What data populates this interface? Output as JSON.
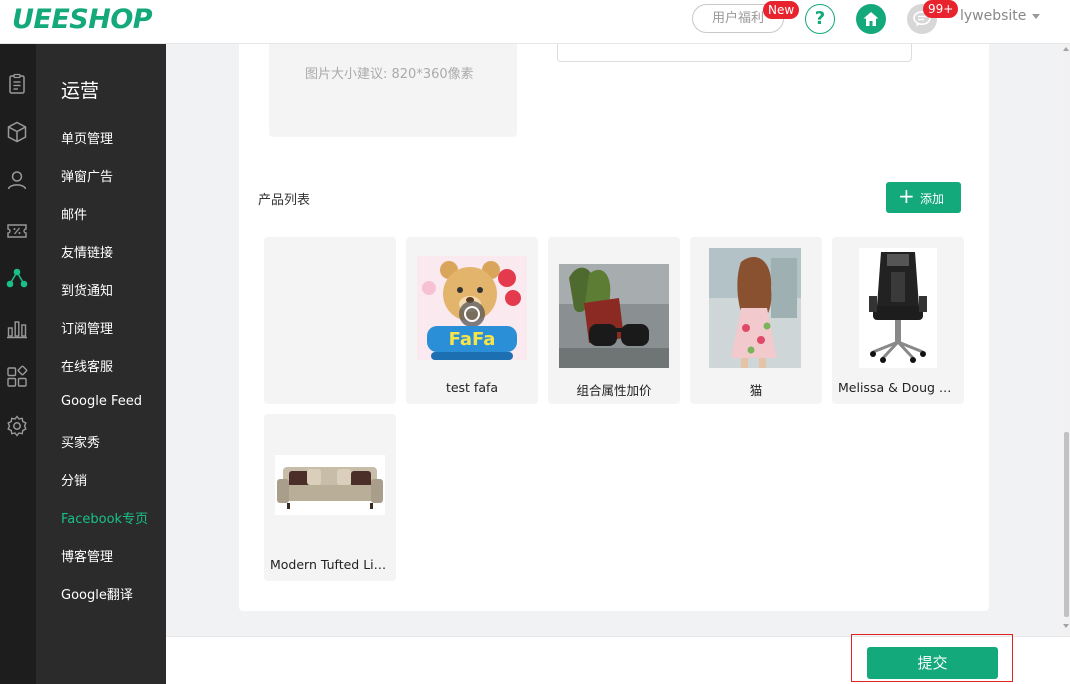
{
  "header": {
    "logo_text": "UEESHOP",
    "welfare_label": "用户福利",
    "new_badge": "New",
    "help_label": "?",
    "message_badge": "99+",
    "username": "lywebsite"
  },
  "iconbar": {
    "icons": [
      "clipboard-icon",
      "package-icon",
      "user-icon",
      "discount-icon",
      "share-icon",
      "bar-chart-icon",
      "apps-icon",
      "settings-icon"
    ],
    "active_icon": "share-icon"
  },
  "submenu": {
    "title": "运营",
    "items": [
      {
        "label": "单页管理"
      },
      {
        "label": "弹窗广告"
      },
      {
        "label": "邮件"
      },
      {
        "label": "友情链接"
      },
      {
        "label": "到货通知"
      },
      {
        "label": "订阅管理"
      },
      {
        "label": "在线客服"
      },
      {
        "label": "Google Feed"
      },
      {
        "label": "买家秀"
      },
      {
        "label": "分销"
      },
      {
        "label": "Facebook专页"
      },
      {
        "label": "博客管理"
      },
      {
        "label": "Google翻译"
      }
    ],
    "active_item": "Facebook专页"
  },
  "main": {
    "upload_tip": "图片大小建议: 820*360像素",
    "section_title": "产品列表",
    "add_button": "添加",
    "products": [
      {
        "name": ""
      },
      {
        "name": "test fafa"
      },
      {
        "name": "组合属性加价"
      },
      {
        "name": "猫"
      },
      {
        "name": "Melissa & Doug S..."
      },
      {
        "name": "Modern Tufted Lin..."
      }
    ]
  },
  "footer": {
    "submit_label": "提交"
  },
  "colors": {
    "brand_green": "#13a97a",
    "active_menu": "#19c089",
    "badge_red": "#e8232d",
    "sidebar_dark": "#2b2b2b",
    "iconbar_dark": "#1d1d1d"
  }
}
